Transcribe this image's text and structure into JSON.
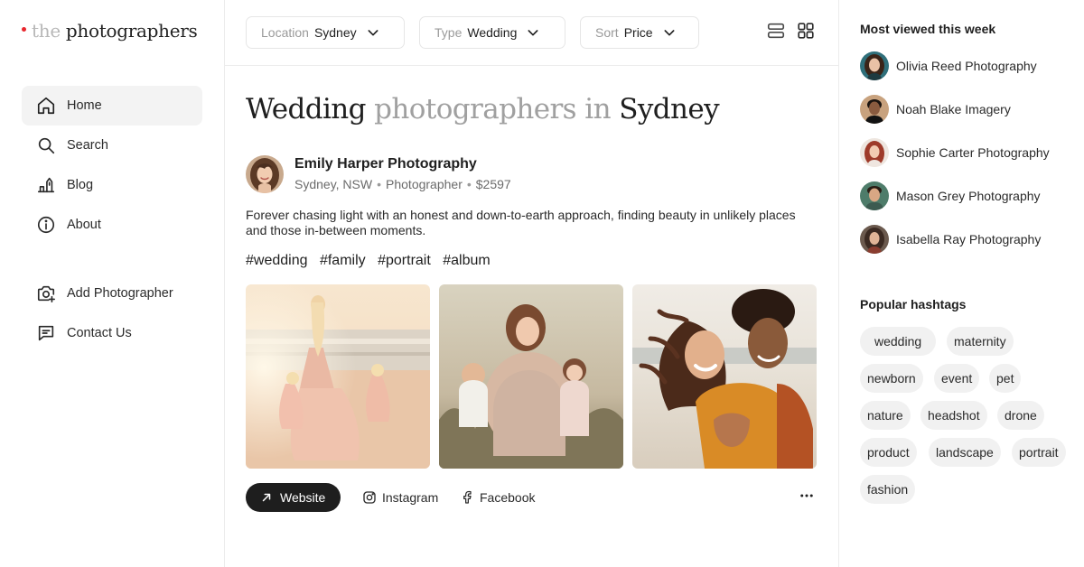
{
  "brand": {
    "part1": "the",
    "part2": "photographers",
    "dot_color": "#e8262d"
  },
  "sidebar": {
    "items": [
      {
        "label": "Home",
        "icon": "home-icon",
        "active": true
      },
      {
        "label": "Search",
        "icon": "search-icon"
      },
      {
        "label": "Blog",
        "icon": "blog-icon"
      },
      {
        "label": "About",
        "icon": "info-icon"
      }
    ],
    "secondary": [
      {
        "label": "Add Photographer",
        "icon": "camera-plus-icon"
      },
      {
        "label": "Contact Us",
        "icon": "message-icon"
      }
    ]
  },
  "filters": {
    "location": {
      "label": "Location",
      "value": "Sydney"
    },
    "type": {
      "label": "Type",
      "value": "Wedding"
    },
    "sort": {
      "label": "Sort",
      "value": "Price"
    }
  },
  "headline": {
    "part1": "Wedding",
    "part2": "photographers in",
    "part3": "Sydney"
  },
  "photographer": {
    "name": "Emily Harper Photography",
    "city": "Sydney, NSW",
    "role": "Photographer",
    "price": "$2597",
    "bio": "Forever chasing light with an honest and down-to-earth approach, finding beauty in unlikely places and those in-between moments.",
    "tags": [
      "#wedding",
      "#family",
      "#portrait",
      "#album"
    ],
    "photos": [
      "beach-mother-daughters-photo",
      "family-meadow-photo",
      "couple-beach-photo"
    ]
  },
  "actions": {
    "website": "Website",
    "instagram": "Instagram",
    "facebook": "Facebook"
  },
  "most_viewed": {
    "title": "Most viewed this week",
    "items": [
      "Olivia Reed Photography",
      "Noah Blake Imagery",
      "Sophie Carter Photography",
      "Mason Grey Photography",
      "Isabella Ray Photography"
    ]
  },
  "hashtags": {
    "title": "Popular hashtags",
    "items": [
      "wedding",
      "maternity",
      "newborn",
      "event",
      "pet",
      "nature",
      "headshot",
      "drone",
      "product",
      "landscape",
      "portrait",
      "fashion"
    ]
  }
}
